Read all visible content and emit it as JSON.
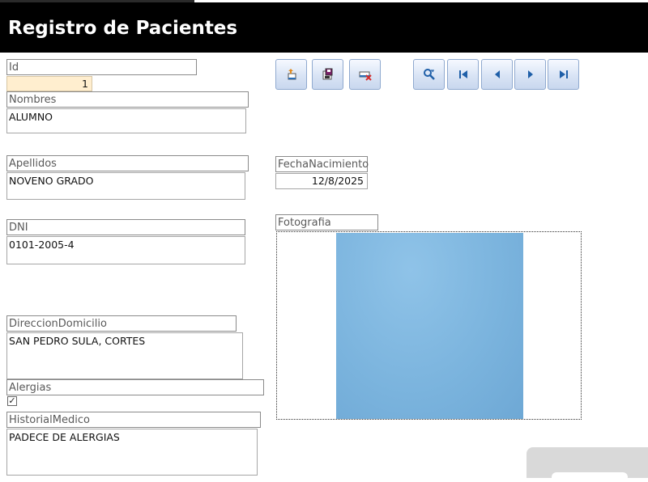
{
  "header": {
    "title": "Registro de Pacientes"
  },
  "form": {
    "id": {
      "label": "Id",
      "value": "1"
    },
    "nombres": {
      "label": "Nombres",
      "value": "ALUMNO"
    },
    "apellidos": {
      "label": "Apellidos",
      "value": "NOVENO GRADO"
    },
    "dni": {
      "label": "DNI",
      "value": "0101-2005-4"
    },
    "direccion": {
      "label": "DireccionDomicilio",
      "value": "SAN PEDRO SULA, CORTES"
    },
    "alergias": {
      "label": "Alergias",
      "checked": true,
      "check_glyph": "✓"
    },
    "historial": {
      "label": "HistorialMedico",
      "value": "PADECE DE ALERGIAS"
    },
    "fecha": {
      "label": "FechaNacimiento",
      "value": "12/8/2025"
    },
    "foto": {
      "label": "Fotografia"
    }
  },
  "toolbar": {
    "buttons": [
      {
        "name": "new-record",
        "icon": "new-record-icon"
      },
      {
        "name": "save-record",
        "icon": "save-icon"
      },
      {
        "name": "delete-record",
        "icon": "delete-icon"
      },
      {
        "name": "search",
        "icon": "search-icon"
      },
      {
        "name": "first-record",
        "icon": "first-record-icon"
      },
      {
        "name": "previous-record",
        "icon": "previous-record-icon"
      },
      {
        "name": "next-record",
        "icon": "next-record-icon"
      },
      {
        "name": "last-record",
        "icon": "last-record-icon"
      }
    ]
  },
  "colors": {
    "header_bg": "#000000",
    "id_field_bg": "#ffeecf",
    "button_icon": "#1f5fa8",
    "photo_blue": "#7ab3dd"
  }
}
